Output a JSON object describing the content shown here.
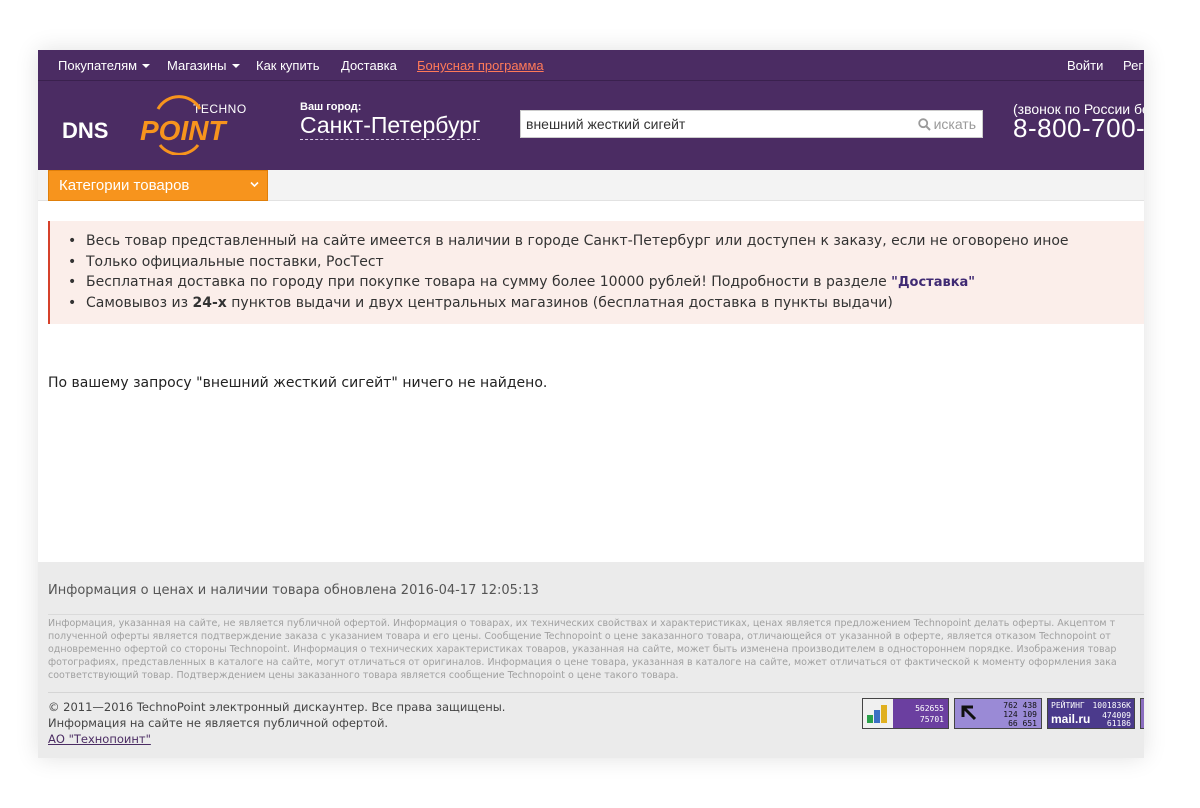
{
  "topbar": {
    "nav": [
      {
        "label": "Покупателям",
        "dropdown": true
      },
      {
        "label": "Магазины",
        "dropdown": true
      },
      {
        "label": "Как купить",
        "dropdown": false
      },
      {
        "label": "Доставка",
        "dropdown": false
      },
      {
        "label": "Бонусная программа",
        "dropdown": false,
        "color": "#ff7a59"
      }
    ],
    "login": "Войти",
    "register": "Рег"
  },
  "header": {
    "logo_dns": "DNS",
    "logo_techno": "TECHNO",
    "logo_point": "POINT",
    "city_label": "Ваш город:",
    "city_name": "Санкт-Петербург",
    "search_value": "внешний жесткий сигейт",
    "search_button": "искать",
    "phone_note": "(звонок по России бе",
    "phone_number": "8-800-700-"
  },
  "catbar": {
    "button_label": "Категории товаров",
    "button_color": "#f7941d"
  },
  "notice": {
    "items": [
      {
        "text": "Весь товар представленный на сайте имеется в наличии в городе Санкт-Петербург или доступен к заказу, если не оговорено иное"
      },
      {
        "text": "Только официальные поставки, РосТест"
      },
      {
        "pre": "Бесплатная доставка по городу при покупке товара на сумму более 10000 рублей! Подробности в разделе ",
        "link": "\"Доставка\""
      },
      {
        "pre": "Самовывоз из ",
        "bold": "24-х",
        "post": " пунктов выдачи и двух центральных магазинов (бесплатная доставка в пункты выдачи)"
      }
    ]
  },
  "result": {
    "text": "По вашему запросу \"внешний жесткий сигейт\" ничего не найдено."
  },
  "footer": {
    "updated": "Информация о ценах и наличии товара обновлена 2016-04-17 12:05:13",
    "disclaimer_lines": [
      "Информация, указанная на сайте, не является публичной офертой. Информация о товарах, их технических свойствах и характеристиках, ценах является предложением Technopoint делать оферты. Акцептом т",
      "полученной оферты является подтверждение заказа с указанием товара и его цены. Сообщение Technopoint о цене заказанного товара, отличающейся от указанной в оферте, является отказом Technopoint от",
      "одновременно офертой со стороны Technopoint. Информация о технических характеристиках товаров, указанная на сайте, может быть изменена производителем в одностороннем порядке. Изображения товар",
      "фотографиях, представленных в каталоге на сайте, могут отличаться от оригиналов. Информация о цене товара, указанная в каталоге на сайте, может отличаться от фактической к моменту оформления зака",
      "соответствующий товар. Подтверждением цены заказанного товара является сообщение Technopoint о цене такого товара."
    ],
    "copyright": "© 2011—2016 TechnoPoint электронный дискаунтер. Все права защищены.",
    "not_offer": "Информация на сайте не является публичной офертой.",
    "company": "АО \"Технопоинт\"",
    "counters": {
      "c1": [
        "562655",
        "75701"
      ],
      "c2": [
        "762 438",
        "124 109",
        "66 651"
      ],
      "c3_title": "РЕЙТИНГ",
      "c3_total": "1001836K",
      "c3_brand": "mail.ru",
      "c3_lines": [
        "474009",
        "61186"
      ]
    }
  }
}
